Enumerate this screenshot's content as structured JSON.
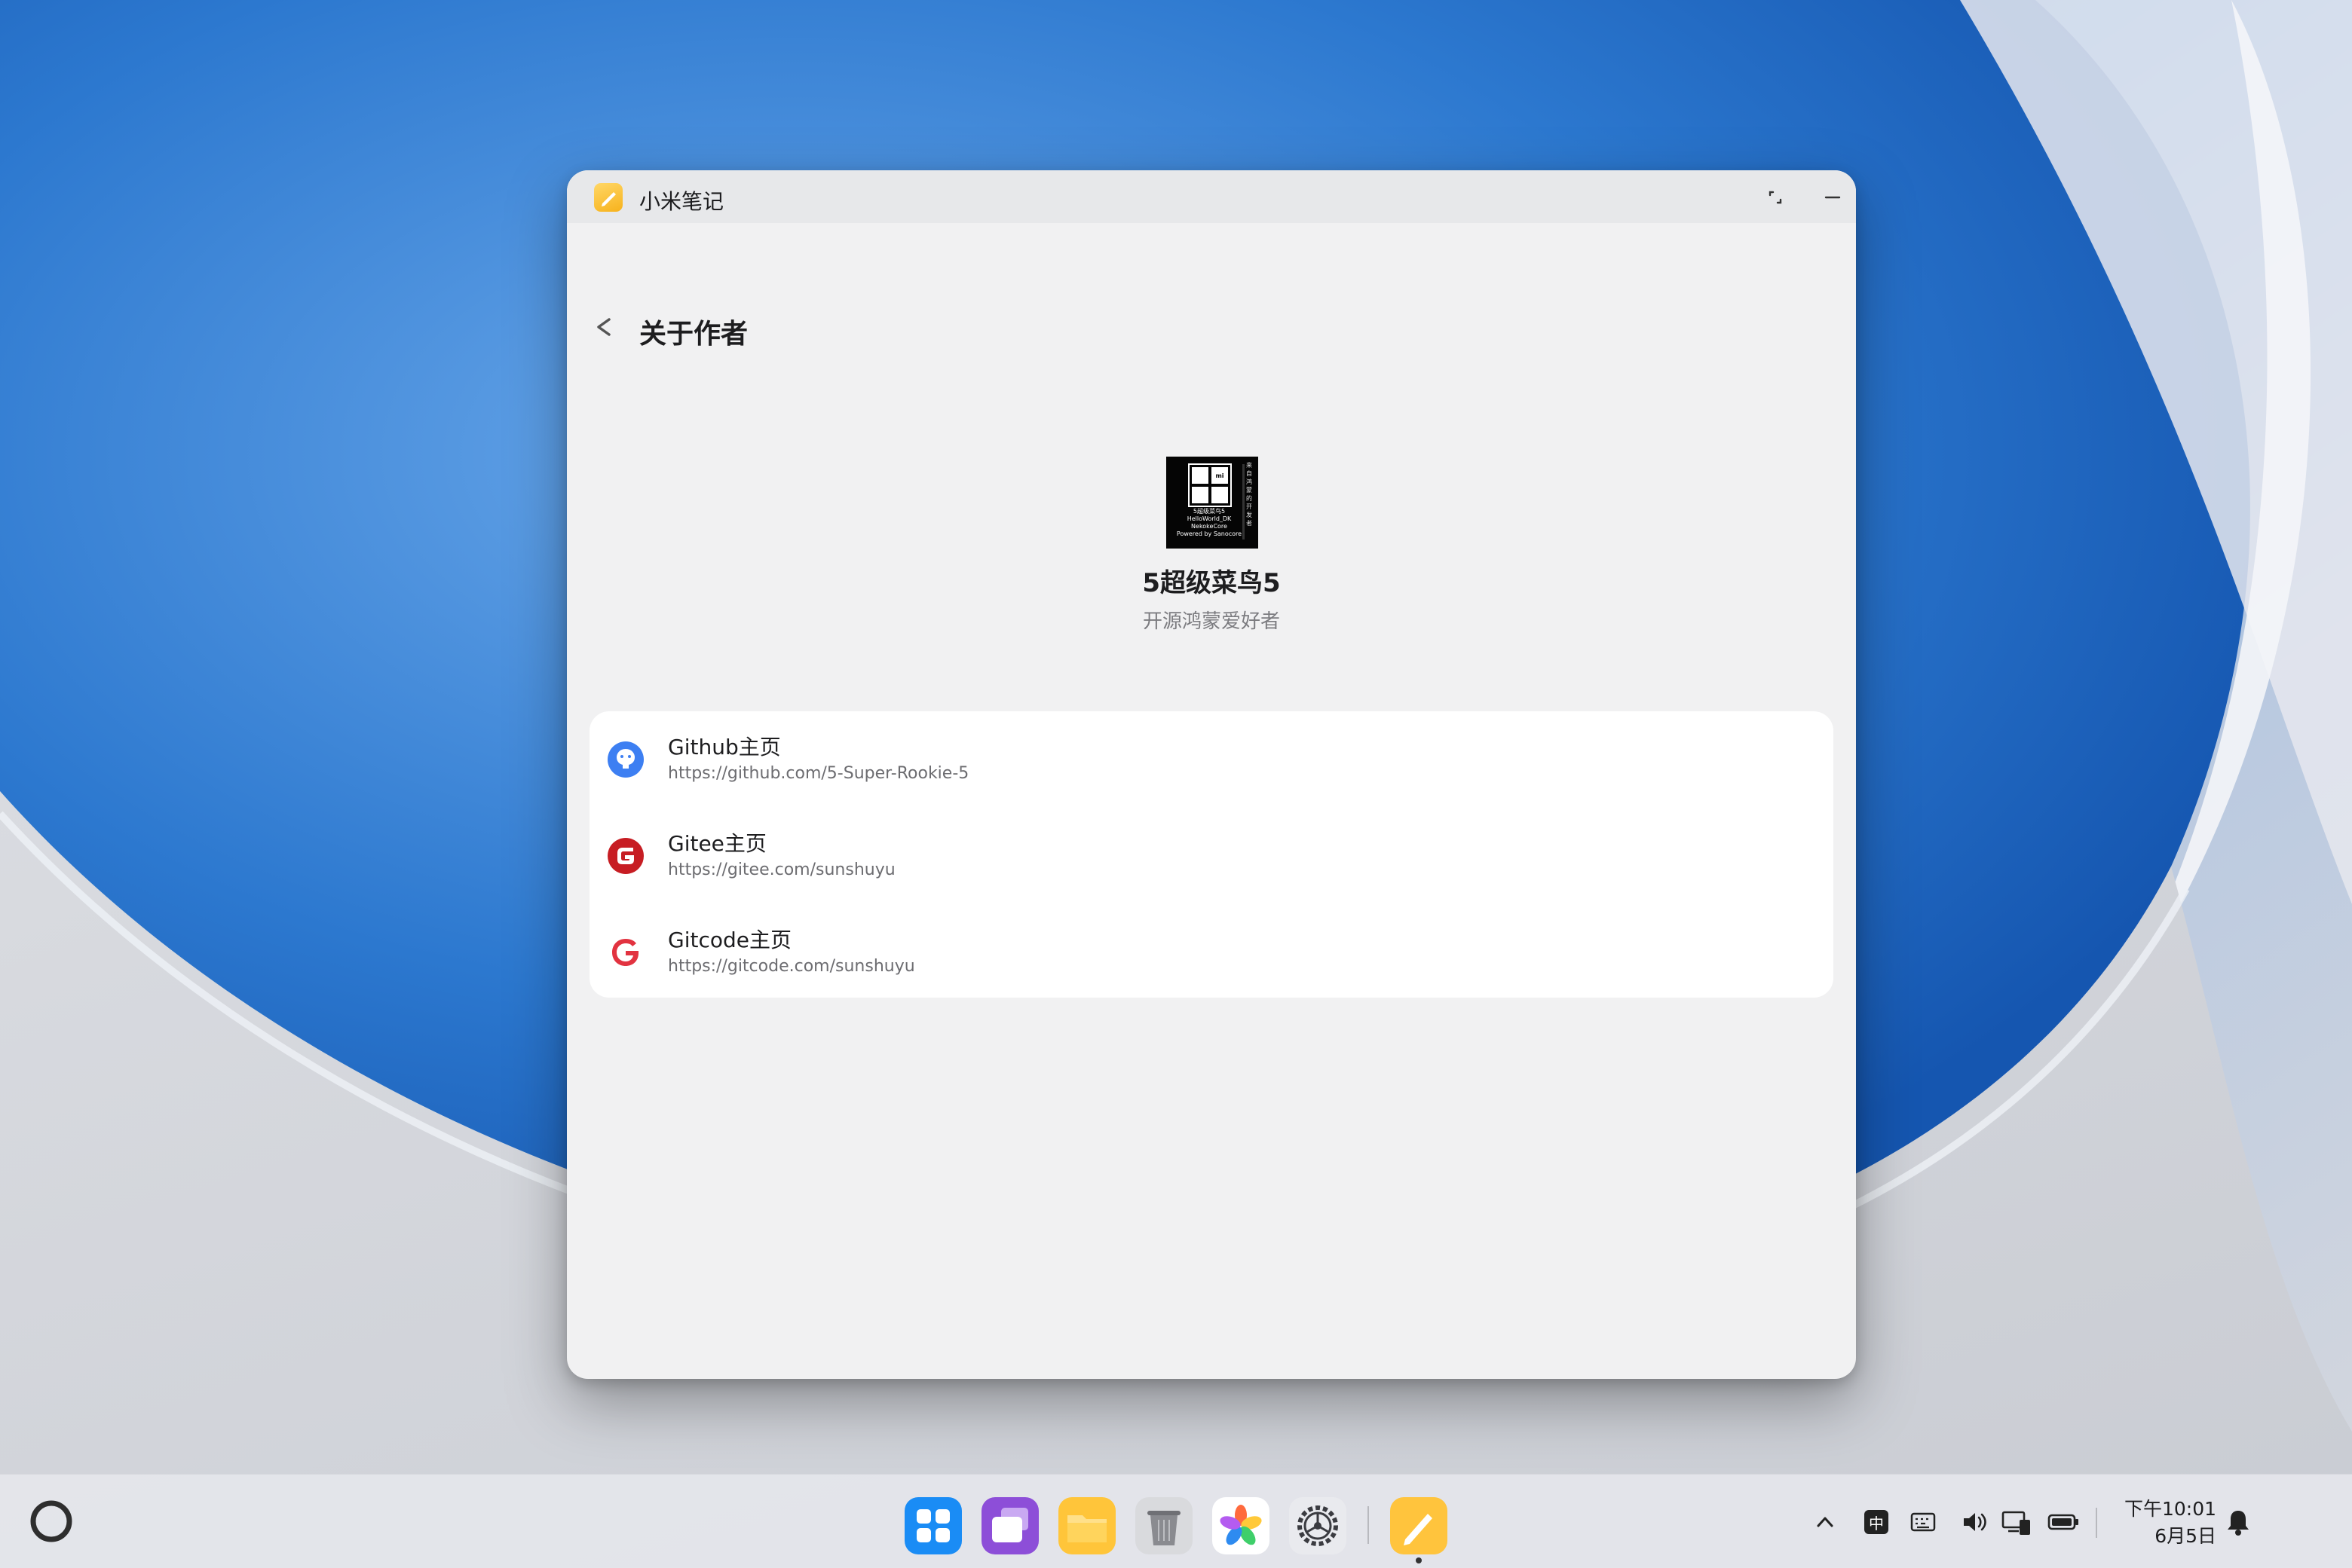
{
  "window": {
    "app_title": "小米笔记",
    "page_title": "关于作者",
    "back_symbol": "<"
  },
  "author": {
    "name": "5超级菜鸟5",
    "bio": "开源鸿蒙爱好者",
    "avatar_lines": [
      "5超级菜鸟5",
      "HelloWorld_DK",
      "NekokeCore",
      "Powered by Sanocore"
    ],
    "avatar_side_text": "来自鸿蒙的开发者"
  },
  "links": [
    {
      "title": "Github主页",
      "url": "https://github.com/5-Super-Rookie-5",
      "icon": "github-icon",
      "color": "#3d7ff2"
    },
    {
      "title": "Gitee主页",
      "url": "https://gitee.com/sunshuyu",
      "icon": "gitee-icon",
      "color": "#c71d23"
    },
    {
      "title": "Gitcode主页",
      "url": "https://gitcode.com/sunshuyu",
      "icon": "gitcode-icon",
      "color": "#e23340"
    }
  ],
  "taskbar": {
    "dock_apps": [
      "app-center-icon",
      "multitask-icon",
      "files-icon",
      "trash-icon",
      "gallery-icon",
      "settings-icon",
      "notes-icon"
    ],
    "input_method": "中",
    "clock_time": "下午10:01",
    "clock_date": "6月5日"
  },
  "colors": {
    "accent_notes": "#f7b21c",
    "window_bg": "#f1f1f2",
    "card_bg": "#ffffff"
  }
}
